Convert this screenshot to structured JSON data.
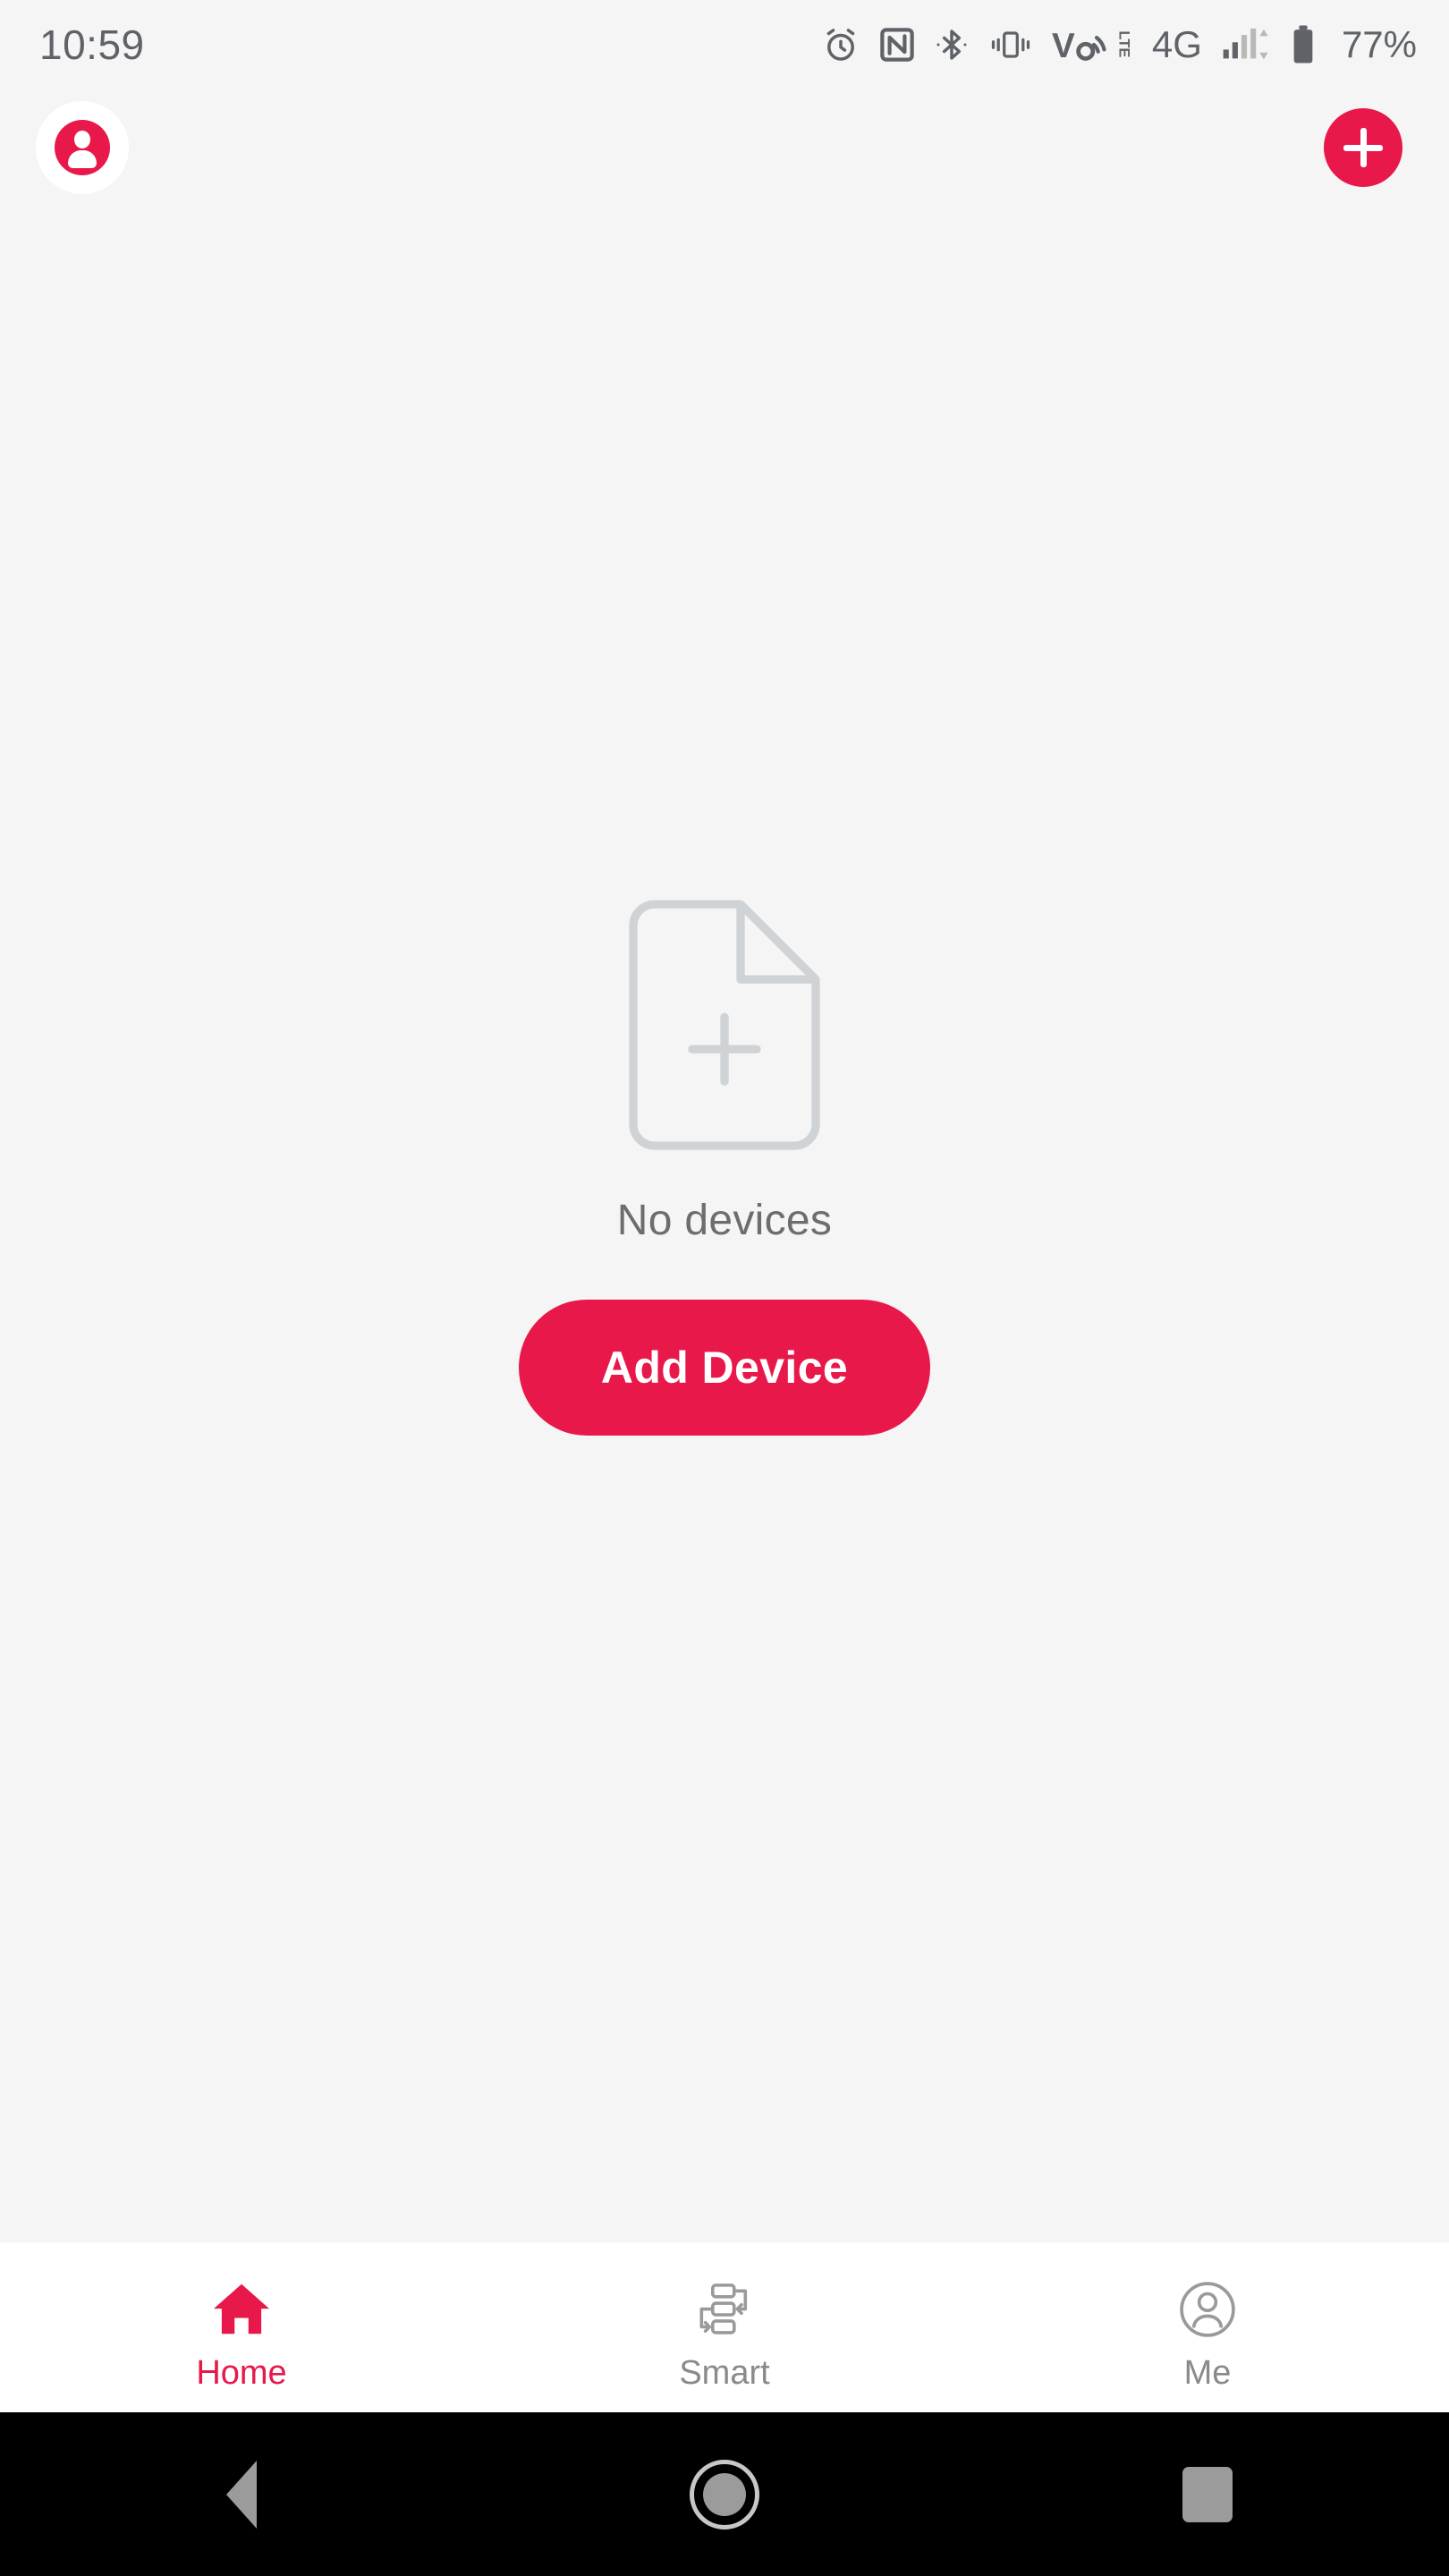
{
  "status_bar": {
    "time": "10:59",
    "network_type": "4G",
    "battery_percent": "77%",
    "icons": [
      {
        "name": "alarm-icon",
        "label": "alarm"
      },
      {
        "name": "nfc-icon",
        "label": "NFC"
      },
      {
        "name": "bluetooth-icon",
        "label": "Bluetooth"
      },
      {
        "name": "vibrate-icon",
        "label": "vibrate"
      },
      {
        "name": "volte-icon",
        "label": "VoLTE"
      },
      {
        "name": "signal-icon",
        "label": "signal"
      },
      {
        "name": "battery-icon",
        "label": "battery"
      }
    ]
  },
  "app_bar": {
    "profile_button": "profile-avatar",
    "add_button": "add"
  },
  "empty_state": {
    "icon": "document-add-icon",
    "message": "No devices",
    "action_label": "Add Device"
  },
  "tab_bar": {
    "tabs": [
      {
        "label": "Home",
        "icon": "home-icon",
        "active": true
      },
      {
        "label": "Smart",
        "icon": "automation-icon",
        "active": false
      },
      {
        "label": "Me",
        "icon": "person-circle-icon",
        "active": false
      }
    ]
  },
  "nav_bar": {
    "back": "back-button",
    "home": "home-button",
    "recents": "recents-button"
  },
  "colors": {
    "accent": "#e8184b",
    "background": "#f5f5f5",
    "tabbar_background": "#ffffff",
    "muted_text": "#6d6d6d",
    "inactive_tab": "#8a8a8a",
    "nav_background": "#000000"
  }
}
